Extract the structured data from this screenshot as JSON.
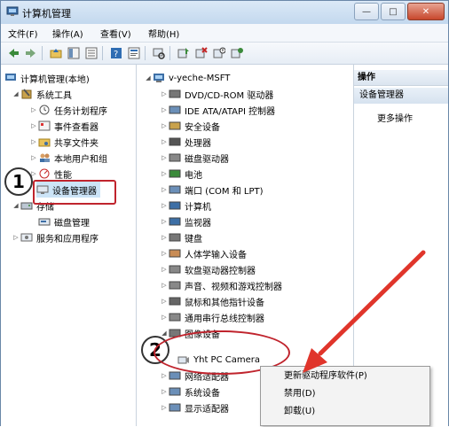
{
  "window": {
    "title": "计算机管理"
  },
  "menubar": {
    "items": [
      "文件(F)",
      "操作(A)",
      "查看(V)",
      "帮助(H)"
    ]
  },
  "left_tree": {
    "root": "计算机管理(本地)",
    "system_tools": "系统工具",
    "task_scheduler": "任务计划程序",
    "event_viewer": "事件查看器",
    "shared_folders": "共享文件夹",
    "local_users": "本地用户和组",
    "performance": "性能",
    "device_manager": "设备管理器",
    "storage": "存储",
    "disk_management": "磁盘管理",
    "services_apps": "服务和应用程序"
  },
  "device_tree": {
    "root": "v-yeche-MSFT",
    "items": [
      "DVD/CD-ROM 驱动器",
      "IDE ATA/ATAPI 控制器",
      "安全设备",
      "处理器",
      "磁盘驱动器",
      "电池",
      "端口 (COM 和 LPT)",
      "计算机",
      "监视器",
      "键盘",
      "人体学输入设备",
      "软盘驱动器控制器",
      "声音、视频和游戏控制器",
      "鼠标和其他指针设备",
      "通用串行总线控制器",
      "图像设备"
    ],
    "camera": "Yht PC Camera",
    "after": [
      "网络适配器",
      "系统设备",
      "显示适配器"
    ]
  },
  "actions_pane": {
    "header": "操作",
    "section": "设备管理器",
    "more": "更多操作"
  },
  "context_menu": {
    "items": [
      "更新驱动程序软件(P)",
      "禁用(D)",
      "卸载(U)"
    ]
  },
  "callouts": {
    "one": "1",
    "two": "2"
  },
  "colors": {
    "highlight": "#c0242d",
    "selection": "#cce4f7",
    "arrow": "#e0352b"
  }
}
